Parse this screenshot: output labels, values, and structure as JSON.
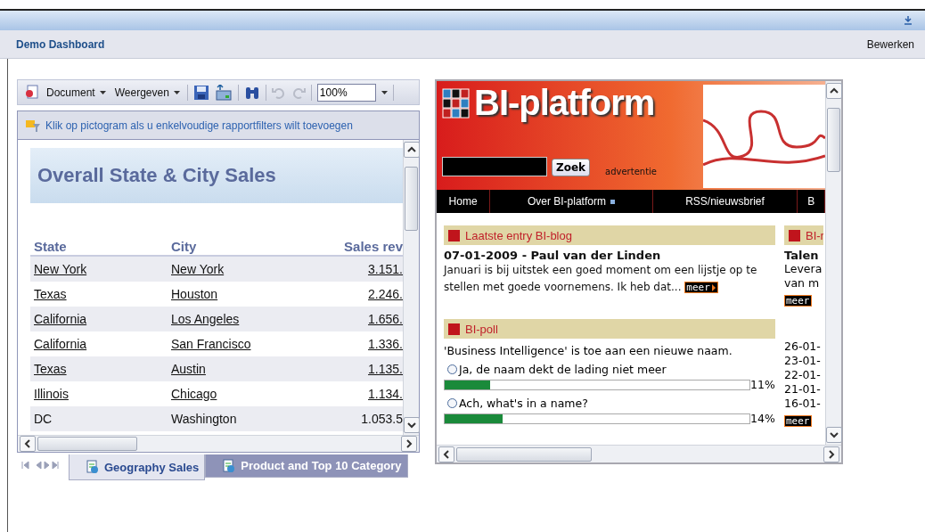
{
  "header": {
    "title": "Demo Dashboard",
    "edit_link": "Bewerken"
  },
  "report_panel": {
    "toolbar": {
      "menus": [
        "Document",
        "Weergeven"
      ],
      "zoom": "100%"
    },
    "filter_hint": "Klik op pictogram als u enkelvoudige rapportfilters wilt toevoegen",
    "report_title": "Overall State & City Sales",
    "table": {
      "columns": [
        "State",
        "City",
        "Sales rev"
      ],
      "rows": [
        [
          "New York",
          "New York",
          "3.151."
        ],
        [
          "Texas",
          "Houston",
          "2.246."
        ],
        [
          "California",
          "Los Angeles",
          "1.656."
        ],
        [
          "California",
          "San Francisco",
          "1.336."
        ],
        [
          "Texas",
          "Austin",
          "1.135."
        ],
        [
          "Illinois",
          "Chicago",
          "1.134."
        ],
        [
          "DC",
          "Washington",
          "1.053.5"
        ]
      ]
    },
    "tabs": [
      {
        "label": "Geography Sales",
        "selected": true
      },
      {
        "label": "Product and Top 10 Category",
        "selected": false
      }
    ]
  },
  "web_panel": {
    "logo": "BI-platform",
    "search_button": "Zoek",
    "ad_label": "advertentie",
    "nav": [
      {
        "label": "Home",
        "submenu": false
      },
      {
        "label": "Over BI-platform",
        "submenu": true
      },
      {
        "label": "RSS/nieuwsbrief",
        "submenu": false
      },
      {
        "label": "B",
        "submenu": false
      }
    ],
    "blog": {
      "heading": "Laatste entry BI-blog",
      "title": "07-01-2009 - Paul van der Linden",
      "text": "Januari is bij uitstek een goed moment om een lijstje op te stellen met goede voornemens. Ik heb dat...",
      "more": "meer"
    },
    "poll": {
      "heading": "BI-poll",
      "question": "'Business Intelligence' is toe aan een nieuwe naam.",
      "options": [
        {
          "label": "Ja, de naam dekt de lading niet meer",
          "selected": false,
          "level": 0.15,
          "reading": "11%"
        },
        {
          "label": "Ach, what's in a name?",
          "selected": false,
          "level": 0.19,
          "reading": "14%"
        }
      ]
    },
    "side": {
      "heading": "BI-r",
      "title": "Talen",
      "lines": [
        "Levera",
        "van m"
      ],
      "more": "meer",
      "dates": [
        "26-01-",
        "23-01-",
        "22-01-",
        "21-01-",
        "16-01-"
      ],
      "more_2": "meer"
    }
  }
}
